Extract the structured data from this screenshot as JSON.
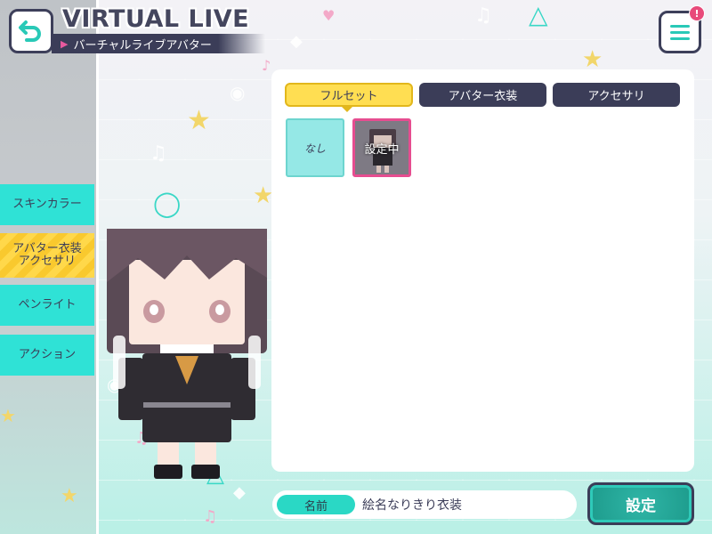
{
  "header": {
    "title": "VIRTUAL LIVE",
    "subtitle": "バーチャルライブアバター",
    "notification_badge": "!"
  },
  "sidebar": {
    "items": [
      {
        "label": "スキンカラー",
        "active": false
      },
      {
        "label": "アバター衣装\nアクセサリ",
        "active": true
      },
      {
        "label": "ペンライト",
        "active": false
      },
      {
        "label": "アクション",
        "active": false
      }
    ]
  },
  "tabs": [
    {
      "label": "フルセット",
      "active": true
    },
    {
      "label": "アバター衣装",
      "active": false
    },
    {
      "label": "アクセサリ",
      "active": false
    }
  ],
  "items": {
    "none_label": "なし",
    "equipped_label": "設定中"
  },
  "name_field": {
    "label": "名前",
    "value": "絵名なりきり衣装"
  },
  "confirm_button": "設定",
  "colors": {
    "accent_teal": "#2fe2d6",
    "active_yellow": "#ffd84a",
    "dark_navy": "#3b3d58",
    "equipped_pink": "#e64d90"
  }
}
